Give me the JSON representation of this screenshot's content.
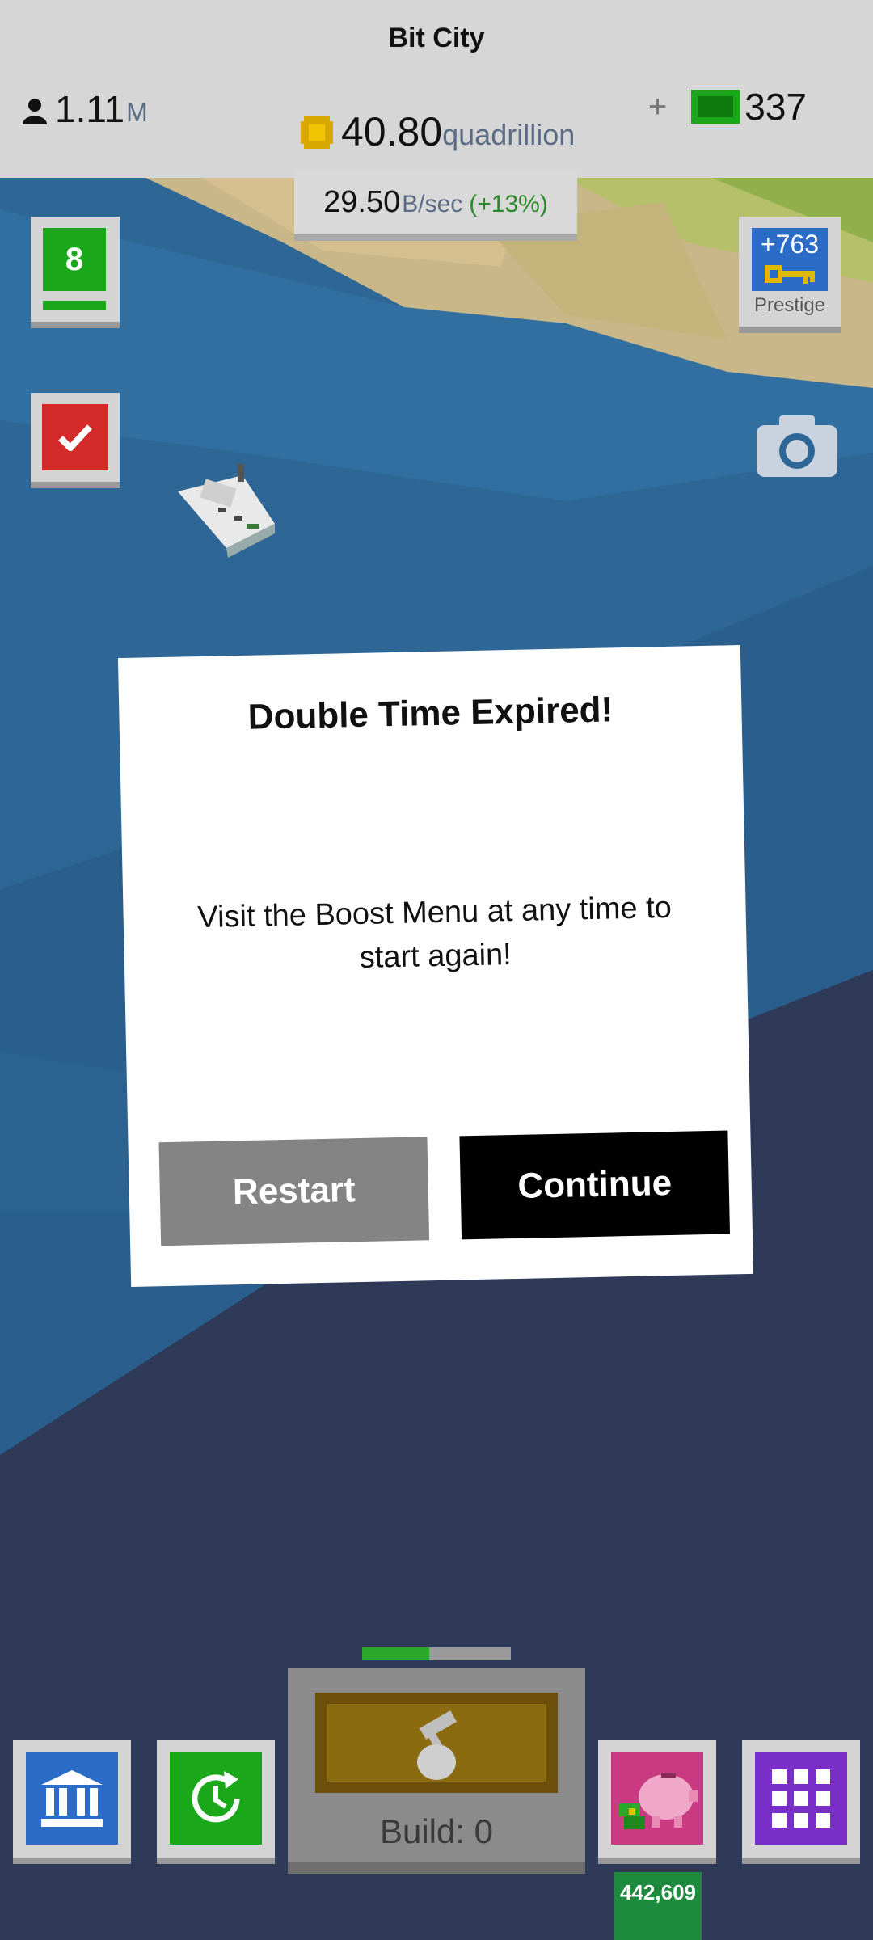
{
  "header": {
    "title": "Bit City",
    "population": {
      "value": "1.11",
      "unit": "M"
    },
    "coins": {
      "value": "40.80",
      "unit": "quadrillion"
    },
    "bux": {
      "plus": "+",
      "value": "337"
    },
    "rate": {
      "value": "29.50",
      "unit": "B/sec",
      "bonus": "(+13%)"
    }
  },
  "side": {
    "level": "8",
    "prestige_count": "+763",
    "prestige_label": "Prestige"
  },
  "dialog": {
    "title": "Double Time Expired!",
    "message": "Visit the Boost Menu at any time to start again!",
    "restart_label": "Restart",
    "continue_label": "Continue"
  },
  "bottom": {
    "build_label": "Build: 0",
    "build_progress": 0.45,
    "bank_count": "442,609"
  },
  "colors": {
    "accent_green": "#1aa81a",
    "accent_blue": "#2a6cc8",
    "accent_red": "#d42a2a",
    "accent_purple": "#7a2ec8",
    "accent_pink": "#c83a82"
  },
  "icons": [
    "person-icon",
    "coin-icon",
    "bux-icon",
    "check-icon",
    "key-icon",
    "camera-icon",
    "boat-icon",
    "bank-icon",
    "time-boost-icon",
    "hammer-icon",
    "piggy-bank-icon",
    "grid-icon"
  ]
}
